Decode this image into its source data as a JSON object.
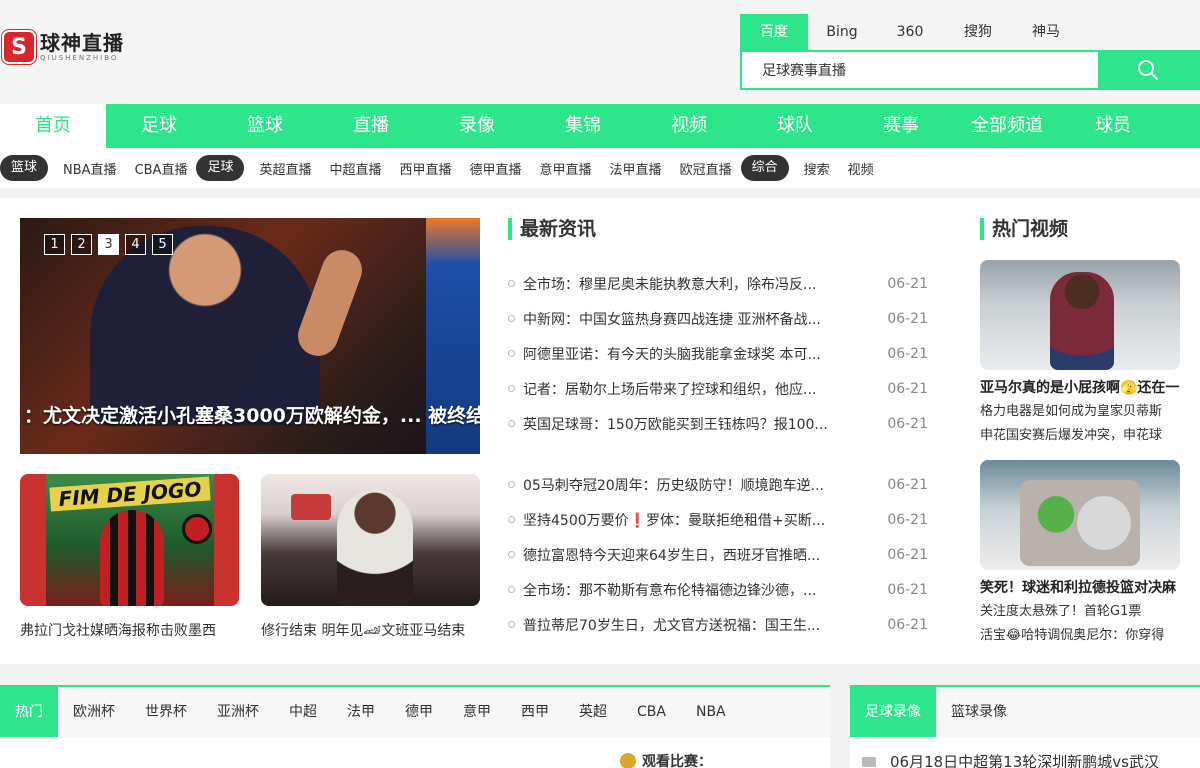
{
  "logo": {
    "mark": "S",
    "title": "球神直播",
    "subtitle": "QIUSHENZHIBO"
  },
  "search": {
    "engines": [
      "百度",
      "Bing",
      "360",
      "搜狗",
      "神马"
    ],
    "active_engine": 0,
    "value": "足球赛事直播"
  },
  "mainnav": [
    "首页",
    "足球",
    "篮球",
    "直播",
    "录像",
    "集锦",
    "视频",
    "球队",
    "赛事",
    "全部频道",
    "球员"
  ],
  "subnav": {
    "basketball": {
      "cat": "篮球",
      "links": [
        "NBA直播",
        "CBA直播"
      ]
    },
    "football": {
      "cat": "足球",
      "links": [
        "英超直播",
        "中超直播",
        "西甲直播",
        "德甲直播",
        "意甲直播",
        "法甲直播",
        "欧冠直播"
      ]
    },
    "general": {
      "cat": "综合",
      "links": [
        "搜索",
        "视频"
      ]
    }
  },
  "banner": {
    "dots": [
      "1",
      "2",
      "3",
      "4",
      "5"
    ],
    "active_dot": 2,
    "caption": "：尤文决定激活小孔塞桑3000万欧解约金，... 被终结"
  },
  "thumbs": [
    {
      "caption": "弗拉门戈社媒晒海报称击败墨西",
      "img_text": "FIM DE JOGO"
    },
    {
      "caption": "修行结束 明年见🏎文班亚马结束"
    }
  ],
  "news": {
    "title": "最新资讯",
    "group1": [
      {
        "t": "全市场：穆里尼奥未能执教意大利，除布冯反...",
        "d": "06-21"
      },
      {
        "t": "中新网：中国女篮热身赛四战连捷 亚洲杯备战...",
        "d": "06-21"
      },
      {
        "t": "阿德里亚诺：有今天的头脑我能拿金球奖 本可...",
        "d": "06-21"
      },
      {
        "t": "记者：居勒尔上场后带来了控球和组织，他应...",
        "d": "06-21"
      },
      {
        "t": "英国足球哥：150万欧能买到王钰栋吗？报100...",
        "d": "06-21"
      }
    ],
    "group2": [
      {
        "t": "05马刺夺冠20周年：历史级防守！顺境跑车逆...",
        "d": "06-21"
      },
      {
        "t": "坚持4500万要价❗罗体：曼联拒绝租借+买断...",
        "d": "06-21"
      },
      {
        "t": "德拉富恩特今天迎来64岁生日，西班牙官推晒...",
        "d": "06-21"
      },
      {
        "t": "全市场：那不勒斯有意布伦特福德边锋沙德，...",
        "d": "06-21"
      },
      {
        "t": "普拉蒂尼70岁生日，尤文官方送祝福：国王生...",
        "d": "06-21"
      }
    ]
  },
  "videos": {
    "title": "热门视频",
    "items": [
      {
        "title": "亚马尔真的是小屁孩啊🫣还在一",
        "lines": [
          "格力电器是如何成为皇家贝蒂斯",
          "申花国安赛后爆发冲突，申花球"
        ]
      },
      {
        "title": "笑死！球迷和利拉德投篮对决麻",
        "lines": [
          "关注度太悬殊了！首轮G1票",
          "活宝😂哈特调侃奥尼尔：你穿得"
        ]
      }
    ]
  },
  "bottom_left": {
    "tabs": [
      "热门",
      "欧洲杯",
      "世界杯",
      "亚洲杯",
      "中超",
      "法甲",
      "德甲",
      "意甲",
      "西甲",
      "英超",
      "CBA",
      "NBA"
    ],
    "watch": "观看比赛："
  },
  "bottom_right": {
    "tabs": [
      "足球录像",
      "篮球录像"
    ],
    "first_item": "06月18日中超第13轮深圳新鹏城vs武汉"
  }
}
